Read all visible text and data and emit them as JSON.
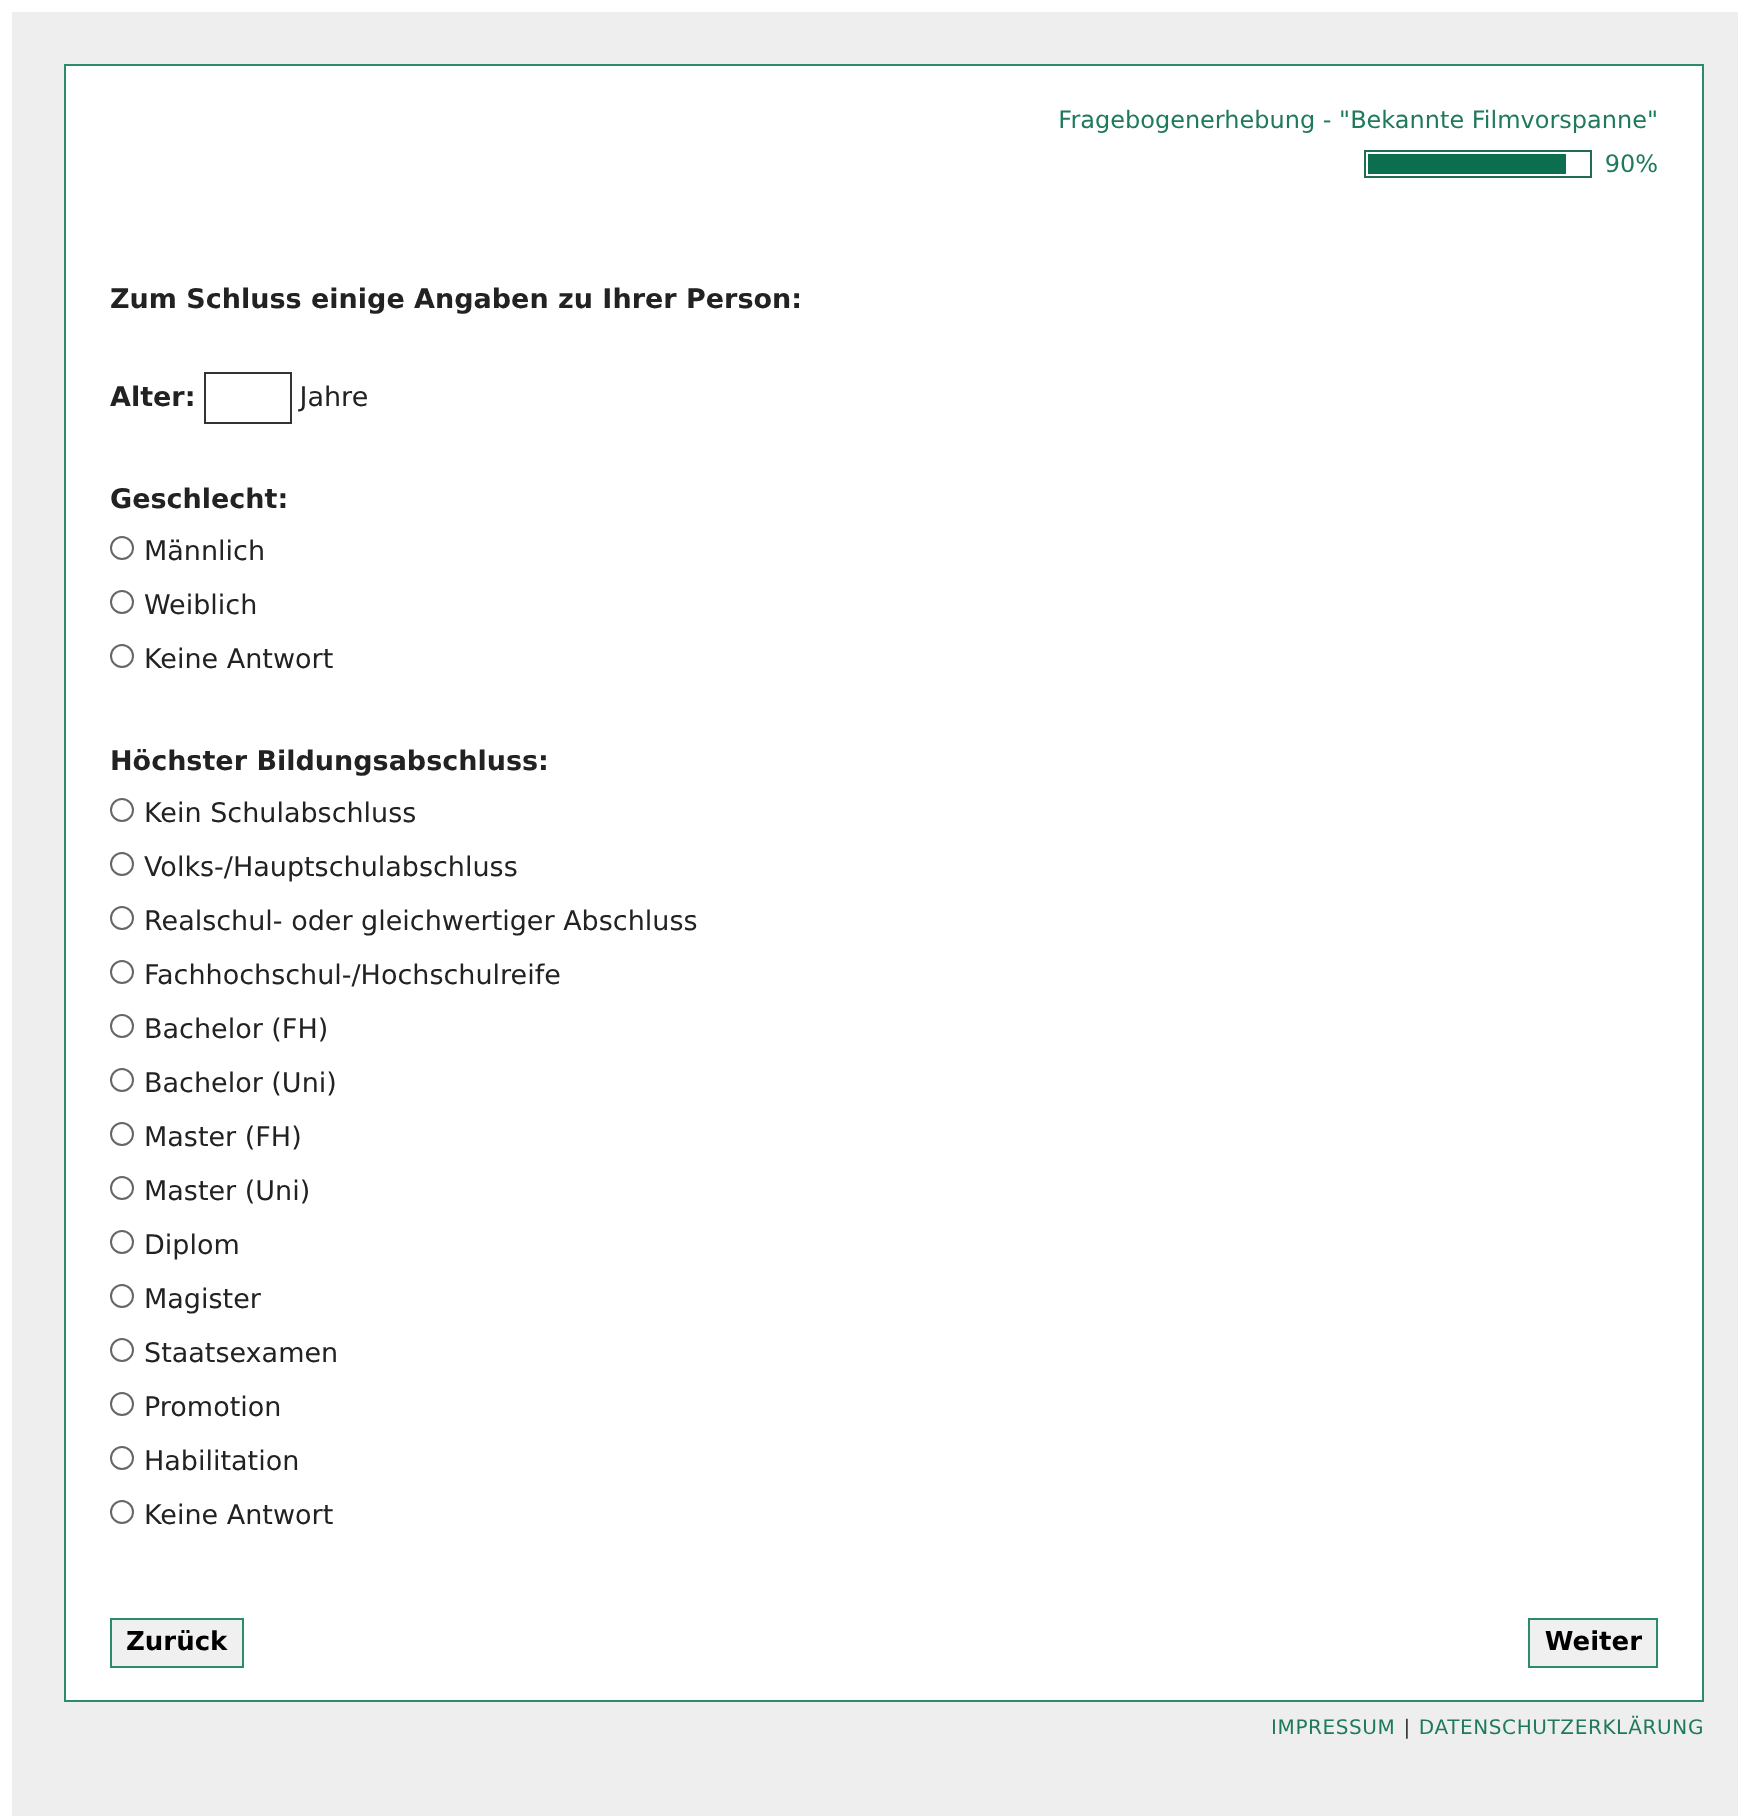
{
  "header": {
    "title": "Fragebogenerhebung - \"Bekannte Filmvorspanne\"",
    "progress": {
      "level": 0.9,
      "reading": "90%"
    }
  },
  "intro": "Zum Schluss einige Angaben zu Ihrer Person:",
  "age": {
    "label": "Alter:",
    "unit": "Jahre"
  },
  "questions": [
    {
      "title": "Geschlecht:",
      "options": [
        {
          "label": "Männlich",
          "selected": false
        },
        {
          "label": "Weiblich",
          "selected": false
        },
        {
          "label": "Keine Antwort",
          "selected": false
        }
      ]
    },
    {
      "title": "Höchster Bildungsabschluss:",
      "options": [
        {
          "label": "Kein Schulabschluss",
          "selected": false
        },
        {
          "label": "Volks-/Hauptschulabschluss",
          "selected": false
        },
        {
          "label": "Realschul- oder gleichwertiger Abschluss",
          "selected": false
        },
        {
          "label": "Fachhochschul-/Hochschulreife",
          "selected": false
        },
        {
          "label": "Bachelor (FH)",
          "selected": false
        },
        {
          "label": "Bachelor (Uni)",
          "selected": false
        },
        {
          "label": "Master (FH)",
          "selected": false
        },
        {
          "label": "Master (Uni)",
          "selected": false
        },
        {
          "label": "Diplom",
          "selected": false
        },
        {
          "label": "Magister",
          "selected": false
        },
        {
          "label": "Staatsexamen",
          "selected": false
        },
        {
          "label": "Promotion",
          "selected": false
        },
        {
          "label": "Habilitation",
          "selected": false
        },
        {
          "label": "Keine Antwort",
          "selected": false
        }
      ]
    }
  ],
  "buttons": {
    "back": "Zurück",
    "next": "Weiter"
  },
  "footer": {
    "links": [
      "IMPRESSUM",
      "DATENSCHUTZERKLÄRUNG"
    ],
    "separator": "|"
  }
}
